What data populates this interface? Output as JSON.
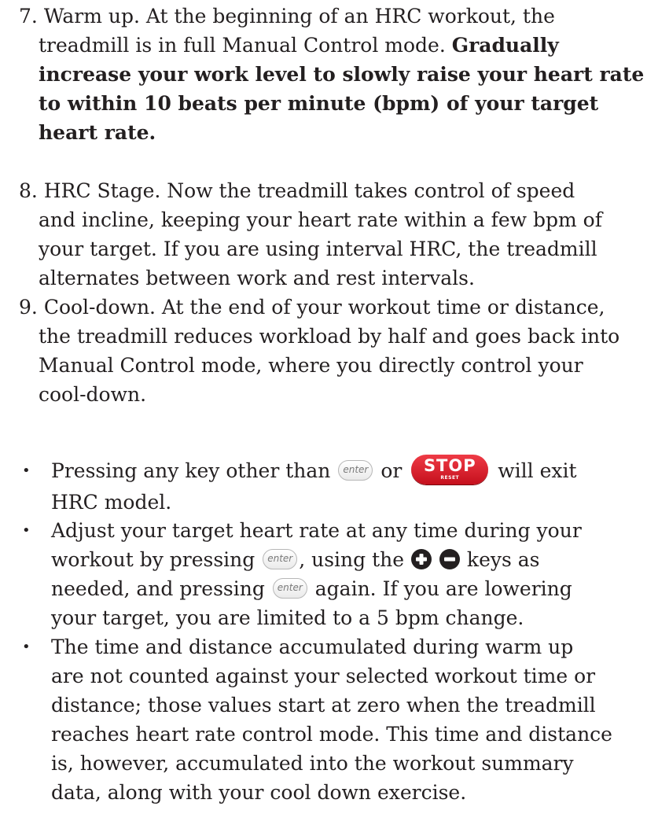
{
  "step7": {
    "number": "7.",
    "text1": "Warm up. At the beginning of an HRC workout, the",
    "text2": "treadmill is in full Manual Control mode.",
    "bold2": "Gradually",
    "bold3": "increase your work level to slowly raise your heart rate",
    "bold4": "to within 10 beats per minute (bpm) of your target",
    "bold5": "heart rate."
  },
  "step8": {
    "number": "8.",
    "lines": [
      "HRC Stage. Now the treadmill takes control of speed",
      "and incline, keeping your heart rate within a few bpm of",
      "your target.  If you are using interval HRC, the treadmill",
      "alternates between work and rest intervals."
    ]
  },
  "step9": {
    "number": "9.",
    "lines": [
      "Cool-down. At the end of your workout time or distance,",
      "the treadmill reduces workload by half and goes back into",
      "Manual Control mode, where you directly control your",
      "cool-down."
    ]
  },
  "keys": {
    "enter_label": "enter",
    "stop_label": "STOP",
    "stop_sublabel": "RESET"
  },
  "bullet1": {
    "dot": "•",
    "part1": "Pressing any key other than",
    "part2": "or",
    "part3": "will exit",
    "line2": "HRC model."
  },
  "bullet2": {
    "dot": "•",
    "line1": "Adjust your target heart rate at any time during your",
    "line2a": "workout by pressing",
    "line2b": ", using the",
    "line2c": "keys as",
    "line3a": "needed, and pressing",
    "line3b": "again.  If you are lowering",
    "line4": "your target, you are limited to a 5 bpm change."
  },
  "bullet3": {
    "dot": "•",
    "lines": [
      "The time and distance accumulated during warm up",
      "are not counted against your selected workout time or",
      "distance; those values start at zero when the treadmill",
      "reaches heart rate control mode.  This time and distance",
      "is, however, accumulated into the workout summary",
      "data, along with your cool down exercise."
    ]
  }
}
